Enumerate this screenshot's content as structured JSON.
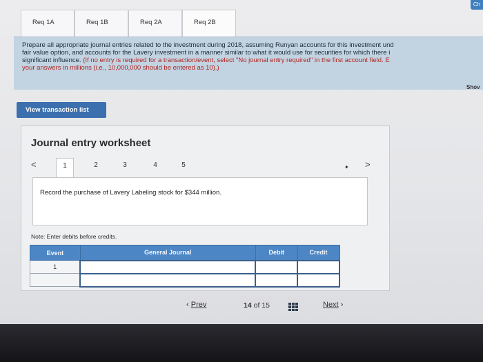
{
  "corner_button": {
    "label": "Ch"
  },
  "tabs": [
    {
      "label": "Req 1A"
    },
    {
      "label": "Req 1B"
    },
    {
      "label": "Req 2A"
    },
    {
      "label": "Req 2B"
    }
  ],
  "instructions": {
    "line1": "Prepare all appropriate journal entries related to the investment during 2018, assuming Runyan accounts for this investment und",
    "line2": "fair value option, and accounts for the Lavery investment in a manner similar to what it would use for securities for which there i",
    "line3a": "significant influence. ",
    "line3b": "(If no entry is required for a transaction/event, select \"No journal entry required\" in the first account field. E",
    "line4": "your answers in millions (i.e., 10,000,000 should be entered as 10).)"
  },
  "show_link": "Shov",
  "view_transaction_button": "View transaction list",
  "worksheet": {
    "title": "Journal entry worksheet",
    "prev_arrow": "<",
    "next_arrow": ">",
    "pages": [
      "1",
      "2",
      "3",
      "4",
      "5"
    ],
    "active_page": "1",
    "record_text": "Record the purchase of Lavery Labeling stock for $344 million.",
    "note": "Note: Enter debits before credits.",
    "table": {
      "headers": [
        "Event",
        "General Journal",
        "Debit",
        "Credit"
      ],
      "rows": [
        {
          "event": "1",
          "account": "",
          "debit": "",
          "credit": ""
        },
        {
          "event": "",
          "account": "",
          "debit": "",
          "credit": ""
        }
      ]
    }
  },
  "pagination": {
    "prev_label": "Prev",
    "prev_glyph": "‹",
    "current": "14",
    "of_text": "of",
    "total": "15",
    "next_label": "Next",
    "next_glyph": "›"
  }
}
